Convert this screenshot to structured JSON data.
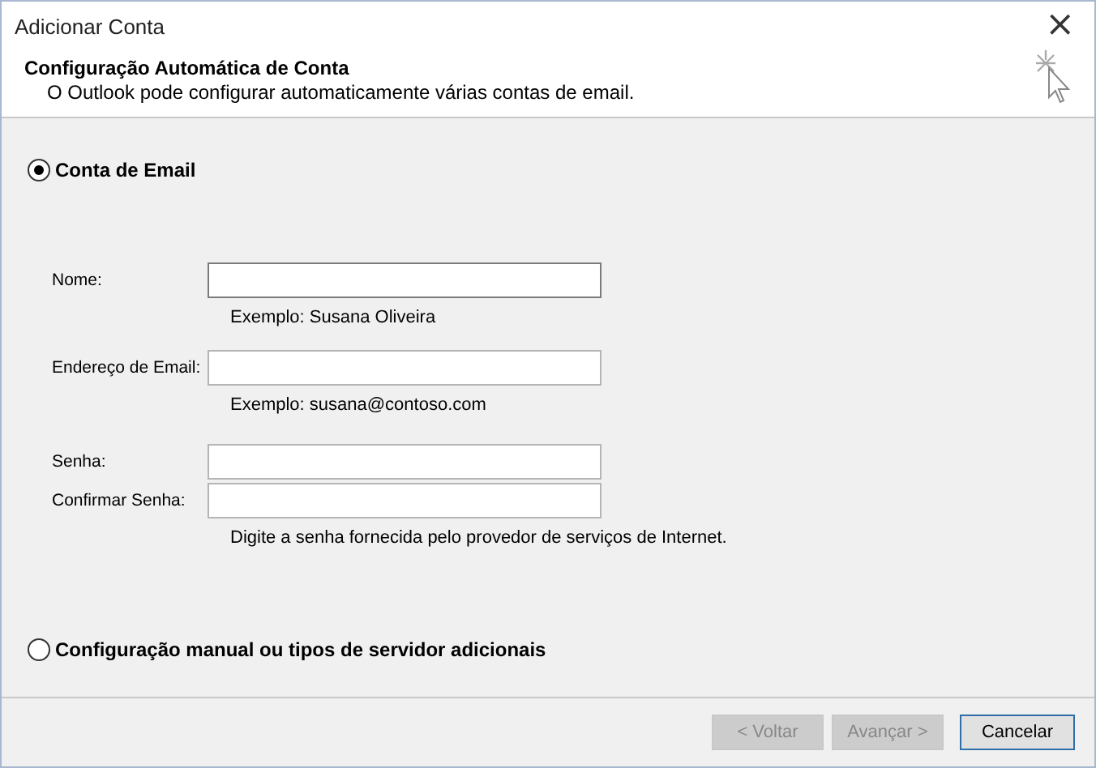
{
  "window": {
    "title": "Adicionar Conta",
    "close": "×"
  },
  "header": {
    "title": "Configuração Automática de Conta",
    "subtitle": "O Outlook pode configurar automaticamente várias contas de email."
  },
  "options": [
    {
      "label": "Conta de Email",
      "selected": true
    },
    {
      "label": "Configuração manual ou tipos de servidor adicionais",
      "selected": false
    }
  ],
  "fields": [
    {
      "label": "Nome:",
      "focused": true,
      "hint": "Exemplo: Susana Oliveira"
    },
    {
      "label": "Endereço de Email:",
      "focused": false,
      "hint": "Exemplo: susana@contoso.com"
    },
    {
      "label": "Senha:",
      "focused": false
    },
    {
      "label": "Confirmar Senha:",
      "focused": false,
      "hint": "Digite a senha fornecida pelo provedor de serviços de Internet."
    }
  ],
  "buttons": [
    {
      "label": "< Voltar",
      "disabled": true,
      "default": false
    },
    {
      "label": "Avançar >",
      "disabled": true,
      "default": false
    },
    {
      "label": "Cancelar",
      "disabled": false,
      "default": true
    }
  ]
}
